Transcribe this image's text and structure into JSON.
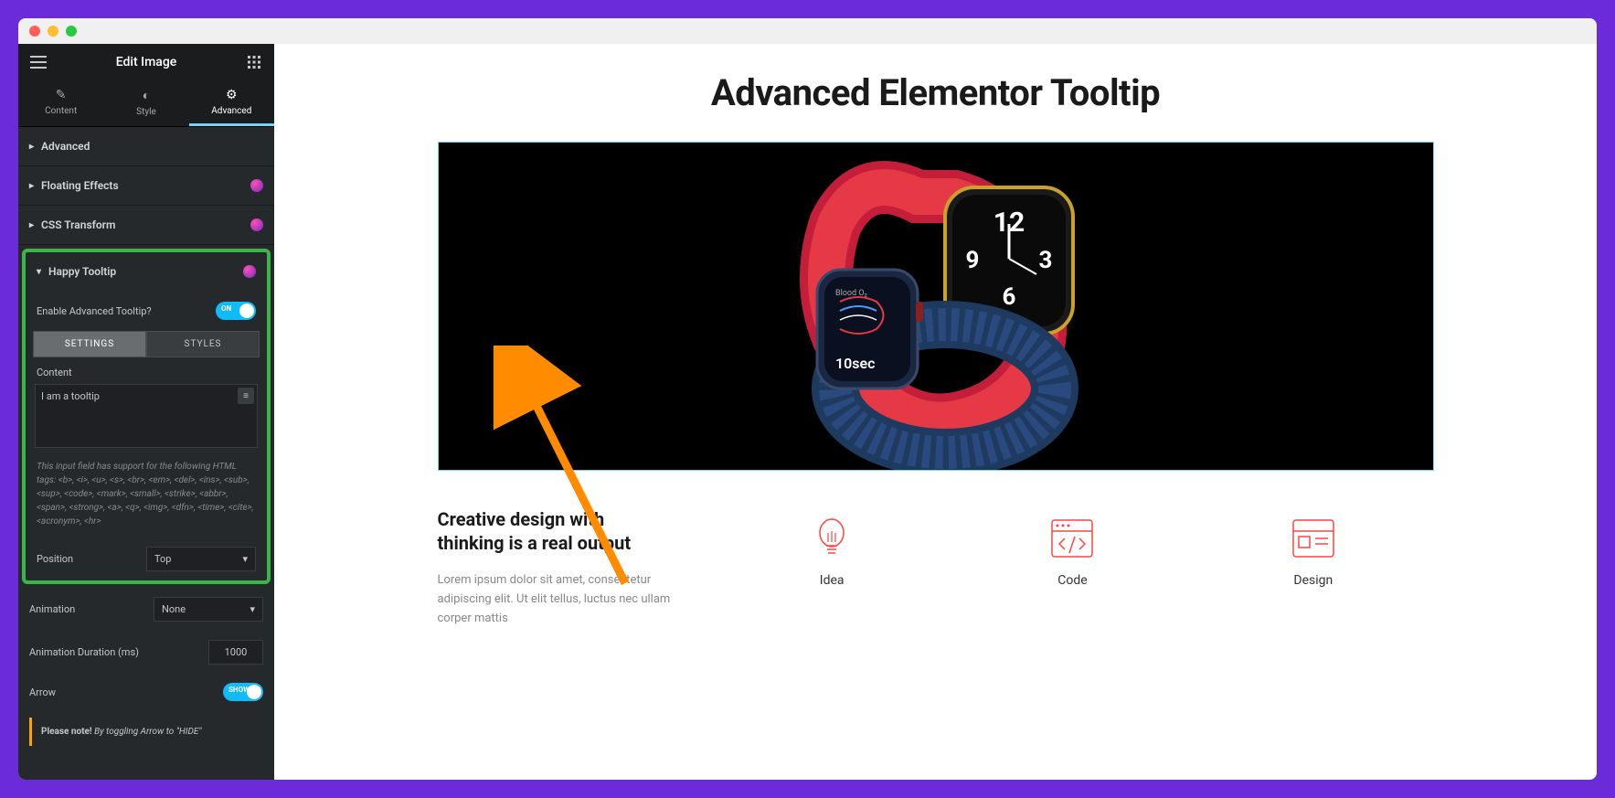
{
  "sidebar": {
    "title": "Edit Image",
    "tabs": {
      "content": "Content",
      "style": "Style",
      "advanced": "Advanced"
    },
    "accordions": {
      "advanced": "Advanced",
      "floating": "Floating Effects",
      "css_transform": "CSS Transform",
      "happy_tooltip": "Happy Tooltip"
    },
    "tooltip": {
      "enable_label": "Enable Advanced Tooltip?",
      "toggle_text": "ON",
      "subtab_settings": "SETTINGS",
      "subtab_styles": "STYLES",
      "content_label": "Content",
      "content_value": "I am a tooltip",
      "help": "This input field has support for the following HTML tags: <b>, <i>, <u>, <s>, <br>, <em>, <del>, <ins>, <sub>, <sup>, <code>, <mark>, <small>, <strike>, <abbr>, <span>, <strong>, <a>, <q>, <img>, <dfn>, <time>, <cite>, <acronym>, <hr>",
      "position_label": "Position",
      "position_value": "Top",
      "animation_label": "Animation",
      "animation_value": "None",
      "duration_label": "Animation Duration (ms)",
      "duration_value": "1000",
      "arrow_label": "Arrow",
      "arrow_toggle": "SHOW",
      "note_bold": "Please note!",
      "note_text": " By toggling Arrow to \"HIDE\""
    }
  },
  "page": {
    "title": "Advanced Elementor Tooltip",
    "heading": "Creative design with thinking is a real output",
    "body": "Lorem ipsum dolor sit amet, consectetur adipiscing elit. Ut elit tellus, luctus nec ullam corper mattis",
    "icons": {
      "idea": "Idea",
      "code": "Code",
      "design": "Design"
    }
  },
  "hero": {
    "time_display": "10sec",
    "blood_oxygen_label": "Blood O₂",
    "clock_numbers": [
      "12",
      "3",
      "6",
      "9"
    ]
  }
}
